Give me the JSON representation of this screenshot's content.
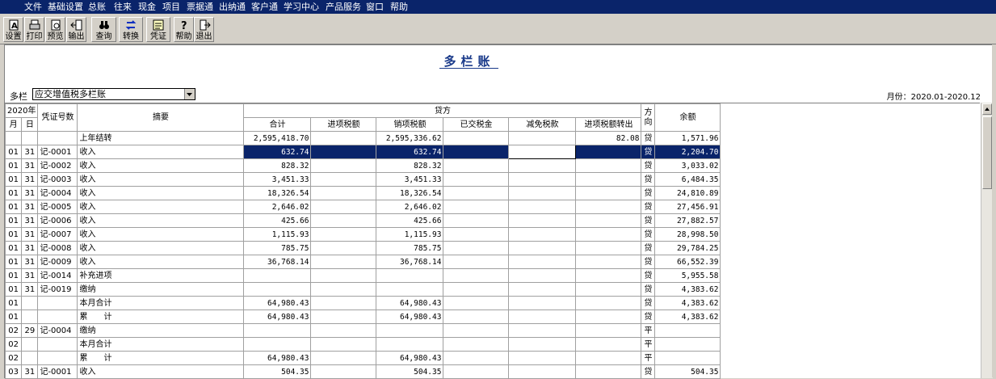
{
  "menu": [
    "文件",
    "基础设置",
    "总账",
    "往来",
    "现金",
    "项目",
    "票据通",
    "出纳通",
    "客户通",
    "学习中心",
    "产品服务",
    "窗口",
    "帮助"
  ],
  "toolbar": [
    {
      "label": "设置",
      "icon": "settings-icon"
    },
    {
      "label": "打印",
      "icon": "print-icon"
    },
    {
      "label": "预览",
      "icon": "preview-icon"
    },
    {
      "label": "输出",
      "icon": "export-icon"
    },
    {
      "label": "查询",
      "icon": "binoculars-icon"
    },
    {
      "label": "转换",
      "icon": "convert-icon"
    },
    {
      "label": "凭证",
      "icon": "voucher-icon"
    },
    {
      "label": "帮助",
      "icon": "help-icon"
    },
    {
      "label": "退出",
      "icon": "exit-icon"
    }
  ],
  "title": "多栏账",
  "multi_label": "多栏",
  "multi_value": "应交增值税多栏账",
  "period": "月份：2020.01-2020.12",
  "header": {
    "year": "2020年",
    "month": "月",
    "day": "日",
    "voucher": "凭证号数",
    "summary": "摘要",
    "credit": "贷方",
    "direction": "方向",
    "balance": "余额",
    "sub": [
      "合计",
      "进项税额",
      "销项税额",
      "已交税金",
      "减免税款",
      "进项税额转出"
    ]
  },
  "rows": [
    {
      "m": "",
      "d": "",
      "v": "",
      "s": "上年结转",
      "total": "2,595,418.70",
      "jx": "",
      "xx": "2,595,336.62",
      "yj": "",
      "jm": "",
      "zc": "82.08",
      "dir": "贷",
      "bal": "1,571.96"
    },
    {
      "m": "01",
      "d": "31",
      "v": "记-0001",
      "s": "收入",
      "total": "632.74",
      "jx": "",
      "xx": "632.74",
      "yj": "",
      "jm": "",
      "zc": "",
      "dir": "贷",
      "bal": "2,204.70"
    },
    {
      "m": "01",
      "d": "31",
      "v": "记-0002",
      "s": "收入",
      "total": "828.32",
      "jx": "",
      "xx": "828.32",
      "yj": "",
      "jm": "",
      "zc": "",
      "dir": "贷",
      "bal": "3,033.02"
    },
    {
      "m": "01",
      "d": "31",
      "v": "记-0003",
      "s": "收入",
      "total": "3,451.33",
      "jx": "",
      "xx": "3,451.33",
      "yj": "",
      "jm": "",
      "zc": "",
      "dir": "贷",
      "bal": "6,484.35"
    },
    {
      "m": "01",
      "d": "31",
      "v": "记-0004",
      "s": "收入",
      "total": "18,326.54",
      "jx": "",
      "xx": "18,326.54",
      "yj": "",
      "jm": "",
      "zc": "",
      "dir": "贷",
      "bal": "24,810.89"
    },
    {
      "m": "01",
      "d": "31",
      "v": "记-0005",
      "s": "收入",
      "total": "2,646.02",
      "jx": "",
      "xx": "2,646.02",
      "yj": "",
      "jm": "",
      "zc": "",
      "dir": "贷",
      "bal": "27,456.91"
    },
    {
      "m": "01",
      "d": "31",
      "v": "记-0006",
      "s": "收入",
      "total": "425.66",
      "jx": "",
      "xx": "425.66",
      "yj": "",
      "jm": "",
      "zc": "",
      "dir": "贷",
      "bal": "27,882.57"
    },
    {
      "m": "01",
      "d": "31",
      "v": "记-0007",
      "s": "收入",
      "total": "1,115.93",
      "jx": "",
      "xx": "1,115.93",
      "yj": "",
      "jm": "",
      "zc": "",
      "dir": "贷",
      "bal": "28,998.50"
    },
    {
      "m": "01",
      "d": "31",
      "v": "记-0008",
      "s": "收入",
      "total": "785.75",
      "jx": "",
      "xx": "785.75",
      "yj": "",
      "jm": "",
      "zc": "",
      "dir": "贷",
      "bal": "29,784.25"
    },
    {
      "m": "01",
      "d": "31",
      "v": "记-0009",
      "s": "收入",
      "total": "36,768.14",
      "jx": "",
      "xx": "36,768.14",
      "yj": "",
      "jm": "",
      "zc": "",
      "dir": "贷",
      "bal": "66,552.39"
    },
    {
      "m": "01",
      "d": "31",
      "v": "记-0014",
      "s": "补充进项",
      "total": "",
      "jx": "",
      "xx": "",
      "yj": "",
      "jm": "",
      "zc": "",
      "dir": "贷",
      "bal": "5,955.58"
    },
    {
      "m": "01",
      "d": "31",
      "v": "记-0019",
      "s": "缴纳",
      "total": "",
      "jx": "",
      "xx": "",
      "yj": "",
      "jm": "",
      "zc": "",
      "dir": "贷",
      "bal": "4,383.62"
    },
    {
      "m": "01",
      "d": "",
      "v": "",
      "s": "本月合计",
      "total": "64,980.43",
      "jx": "",
      "xx": "64,980.43",
      "yj": "",
      "jm": "",
      "zc": "",
      "dir": "贷",
      "bal": "4,383.62"
    },
    {
      "m": "01",
      "d": "",
      "v": "",
      "s": "累　　计",
      "total": "64,980.43",
      "jx": "",
      "xx": "64,980.43",
      "yj": "",
      "jm": "",
      "zc": "",
      "dir": "贷",
      "bal": "4,383.62"
    },
    {
      "m": "02",
      "d": "29",
      "v": "记-0004",
      "s": "缴纳",
      "total": "",
      "jx": "",
      "xx": "",
      "yj": "",
      "jm": "",
      "zc": "",
      "dir": "平",
      "bal": ""
    },
    {
      "m": "02",
      "d": "",
      "v": "",
      "s": "本月合计",
      "total": "",
      "jx": "",
      "xx": "",
      "yj": "",
      "jm": "",
      "zc": "",
      "dir": "平",
      "bal": ""
    },
    {
      "m": "02",
      "d": "",
      "v": "",
      "s": "累　　计",
      "total": "64,980.43",
      "jx": "",
      "xx": "64,980.43",
      "yj": "",
      "jm": "",
      "zc": "",
      "dir": "平",
      "bal": ""
    },
    {
      "m": "03",
      "d": "31",
      "v": "记-0001",
      "s": "收入",
      "total": "504.35",
      "jx": "",
      "xx": "504.35",
      "yj": "",
      "jm": "",
      "zc": "",
      "dir": "贷",
      "bal": "504.35"
    }
  ],
  "selected_row": 1,
  "colors": {
    "menubar": "#0a246a",
    "selection": "#0a246a",
    "title": "#1a3a8a",
    "window": "#d4d0c8"
  }
}
